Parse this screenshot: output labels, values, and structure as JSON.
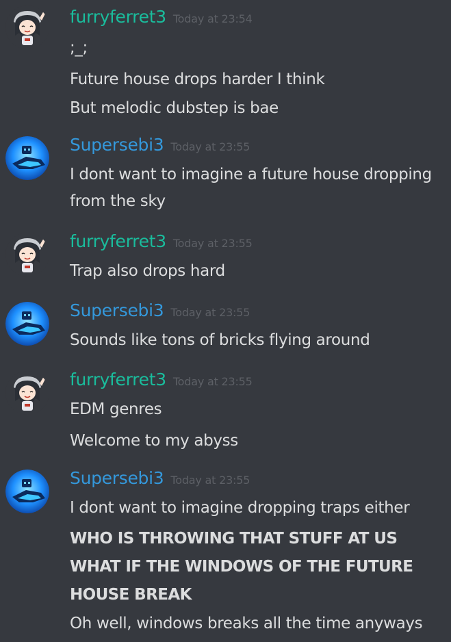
{
  "colors": {
    "background": "#36393f",
    "text": "#dcddde",
    "timestamp": "#5d6066",
    "user_green": "#1abc9c",
    "user_blue": "#3498db"
  },
  "messages": [
    {
      "username": "furryferret3",
      "timestamp": "Today at 23:54",
      "avatar": "anime-girl-avatar",
      "lines": [
        ";_;",
        "Future house drops harder I think",
        "But melodic dubstep is bae"
      ]
    },
    {
      "username": "Supersebi3",
      "timestamp": "Today at 23:55",
      "avatar": "blue-robot-avatar",
      "lines": [
        "I dont want to imagine a future house dropping",
        "from the sky"
      ]
    },
    {
      "username": "furryferret3",
      "timestamp": "Today at 23:55",
      "avatar": "anime-girl-avatar",
      "lines": [
        "Trap also drops hard"
      ]
    },
    {
      "username": "Supersebi3",
      "timestamp": "Today at 23:55",
      "avatar": "blue-robot-avatar",
      "lines": [
        "Sounds like tons of bricks flying around"
      ]
    },
    {
      "username": "furryferret3",
      "timestamp": "Today at 23:55",
      "avatar": "anime-girl-avatar",
      "lines": [
        "EDM genres",
        "Welcome to my abyss"
      ]
    },
    {
      "username": "Supersebi3",
      "timestamp": "Today at 23:55",
      "avatar": "blue-robot-avatar",
      "lines": [
        "I dont want to imagine dropping traps either",
        "WHO IS THROWING THAT STUFF AT US",
        "WHAT IF THE WINDOWS OF THE FUTURE",
        "HOUSE BREAK",
        "Oh well, windows breaks all the time anyways"
      ]
    }
  ]
}
